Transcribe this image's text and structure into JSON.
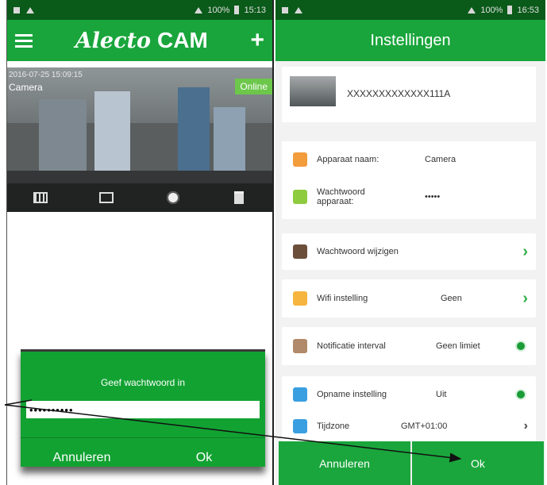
{
  "left_phone": {
    "status": {
      "time": "15:13",
      "battery": "100%"
    },
    "appbar": {
      "logo": "Alecto",
      "title": "CAM",
      "add_symbol": "+"
    },
    "camera": {
      "timestamp": "2016-07-25 15:09:15",
      "name": "Camera",
      "status_badge": "Online",
      "toolbar_icons": [
        "grid-icon",
        "picture-icon",
        "gear-icon",
        "trash-icon"
      ]
    },
    "dialog": {
      "title": "Geef wachtwoord in",
      "password_value": "••••••••••",
      "cancel_label": "Annuleren",
      "ok_label": "Ok"
    }
  },
  "right_phone": {
    "status": {
      "time": "16:53",
      "battery": "100%"
    },
    "title": "Instellingen",
    "device_id": "XXXXXXXXXXXXX111A",
    "rows": {
      "device_name": {
        "label": "Apparaat naam:",
        "value": "Camera",
        "color": "#f39c3c"
      },
      "device_password": {
        "label": "Wachtwoord apparaat:",
        "value": "•••••",
        "color": "#8ecb3f"
      },
      "change_password": {
        "label": "Wachtwoord wijzigen",
        "color": "#6b4f3a"
      },
      "wifi": {
        "label": "Wifi instelling",
        "value": "Geen",
        "color": "#f6b53e"
      },
      "notification": {
        "label": "Notificatie interval",
        "value": "Geen limiet",
        "color": "#b08a6a"
      },
      "recording": {
        "label": "Opname instelling",
        "value": "Uit",
        "color": "#3a9fe0"
      },
      "timezone": {
        "label": "Tijdzone",
        "value": "GMT+01:00",
        "color": "#3a9fe0"
      }
    },
    "bottom": {
      "cancel_label": "Annuleren",
      "ok_label": "Ok"
    }
  },
  "colors": {
    "green": "#19a53b",
    "dark_green": "#0a5a19",
    "online": "#6cc74b"
  }
}
